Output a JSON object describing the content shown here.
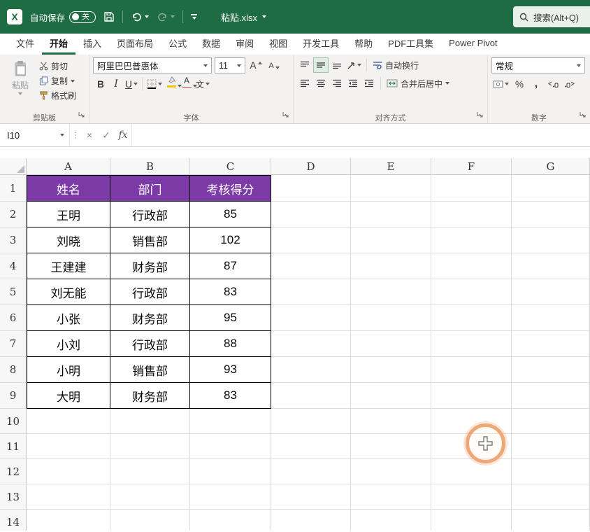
{
  "app": {
    "title_bar": {
      "autosave_label": "自动保存",
      "autosave_state": "关",
      "filename": "粘贴.xlsx",
      "search_text": "搜索(Alt+Q)"
    },
    "menu_tabs": [
      "文件",
      "开始",
      "插入",
      "页面布局",
      "公式",
      "数据",
      "审阅",
      "视图",
      "开发工具",
      "帮助",
      "PDF工具集",
      "Power Pivot"
    ],
    "active_tab": "开始"
  },
  "ribbon": {
    "clipboard": {
      "group_label": "剪贴板",
      "paste": "粘贴",
      "cut": "剪切",
      "copy": "复制",
      "format_painter": "格式刷"
    },
    "font": {
      "group_label": "字体",
      "font_name": "阿里巴巴普惠体",
      "font_size": "11",
      "bold": "B",
      "italic": "I",
      "underline": "U",
      "grow_font": "A",
      "shrink_font": "A",
      "font_color_label": "A",
      "phonetic": "文"
    },
    "alignment": {
      "group_label": "对齐方式",
      "wrap_text": "自动换行",
      "merge_center": "合并后居中"
    },
    "number": {
      "group_label": "数字",
      "format": "常规",
      "percent": "%",
      "comma": ","
    }
  },
  "formula_bar": {
    "name_box": "I10",
    "fx_label": "fx",
    "content": ""
  },
  "sheet": {
    "column_headers": [
      "A",
      "B",
      "C",
      "D",
      "E",
      "F",
      "G"
    ],
    "row_headers": [
      "1",
      "2",
      "3",
      "4",
      "5",
      "6",
      "7",
      "8",
      "9",
      "10",
      "11",
      "12",
      "13",
      "14"
    ],
    "table": {
      "headers": [
        "姓名",
        "部门",
        "考核得分"
      ],
      "rows": [
        [
          "王明",
          "行政部",
          "85"
        ],
        [
          "刘晓",
          "销售部",
          "102"
        ],
        [
          "王建建",
          "财务部",
          "87"
        ],
        [
          "刘无能",
          "行政部",
          "83"
        ],
        [
          "小张",
          "财务部",
          "95"
        ],
        [
          "小刘",
          "行政部",
          "88"
        ],
        [
          "小明",
          "销售部",
          "93"
        ],
        [
          "大明",
          "财务部",
          "83"
        ]
      ]
    }
  },
  "colors": {
    "titlebar_green": "#1E6C43",
    "accent_green": "#1E6C43",
    "table_header_purple": "#7C3AA6",
    "font_color_red": "#D13438",
    "fill_color_yellow": "#FFC000"
  }
}
